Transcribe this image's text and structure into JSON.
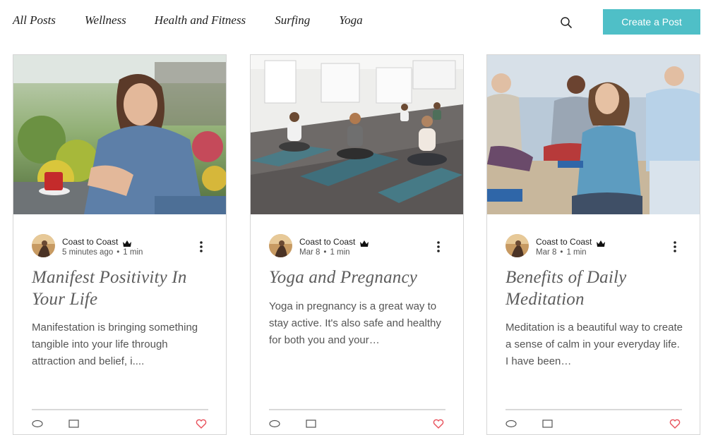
{
  "nav": {
    "items": [
      "All Posts",
      "Wellness",
      "Health and Fitness",
      "Surfing",
      "Yoga"
    ]
  },
  "header": {
    "search_icon": "search-icon",
    "create_label": "Create a Post",
    "create_color": "#4fbfc7"
  },
  "posts": [
    {
      "author": "Coast to Coast",
      "time": "5 minutes ago",
      "read": "1 min",
      "title": "Manifest Positivity In Your Life",
      "excerpt": "Manifestation is bringing something tangible into your life through attraction and belief, i...."
    },
    {
      "author": "Coast to Coast",
      "time": "Mar 8",
      "read": "1 min",
      "title": "Yoga and Pregnancy",
      "excerpt": "Yoga in pregnancy is a great way to stay active. It's also safe and healthy for both you and your…"
    },
    {
      "author": "Coast to Coast",
      "time": "Mar 8",
      "read": "1 min",
      "title": "Benefits of Daily Meditation",
      "excerpt": "Meditation is a beautiful way to create a sense of calm in your everyday life. I have been…"
    }
  ],
  "colors": {
    "accent": "#4fbfc7",
    "like": "#e8505b",
    "border": "#d6d6d6"
  }
}
